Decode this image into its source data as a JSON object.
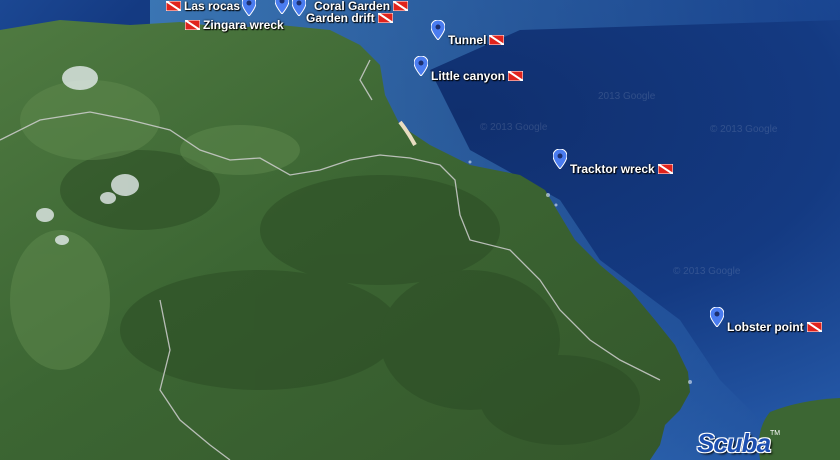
{
  "map": {
    "colors": {
      "ocean_deep": "#0a2a5e",
      "ocean_mid": "#1f4fa0",
      "ocean_shallow": "#3f8ad0",
      "land": "#3f6a35",
      "land_dark": "#2b4d24",
      "road": "#c9c9c9",
      "pin": "#4a7cf0",
      "flag_red": "#e0231c"
    },
    "dive_sites": [
      {
        "name": "Las rocas",
        "flag_side": "left"
      },
      {
        "name": "Zingara wreck",
        "flag_side": "left"
      },
      {
        "name": "Coral Garden",
        "flag_side": "right"
      },
      {
        "name": "Garden drift",
        "flag_side": "right"
      },
      {
        "name": "Tunnel",
        "flag_side": "right"
      },
      {
        "name": "Little canyon",
        "flag_side": "right"
      },
      {
        "name": "Tracktor wreck",
        "flag_side": "right"
      },
      {
        "name": "Lobster point",
        "flag_side": "right"
      }
    ],
    "watermark_text": "© 2013 Google",
    "watermark_text_short": "2013 Google",
    "logo_text": "Scuba",
    "logo_tm": "TM"
  }
}
